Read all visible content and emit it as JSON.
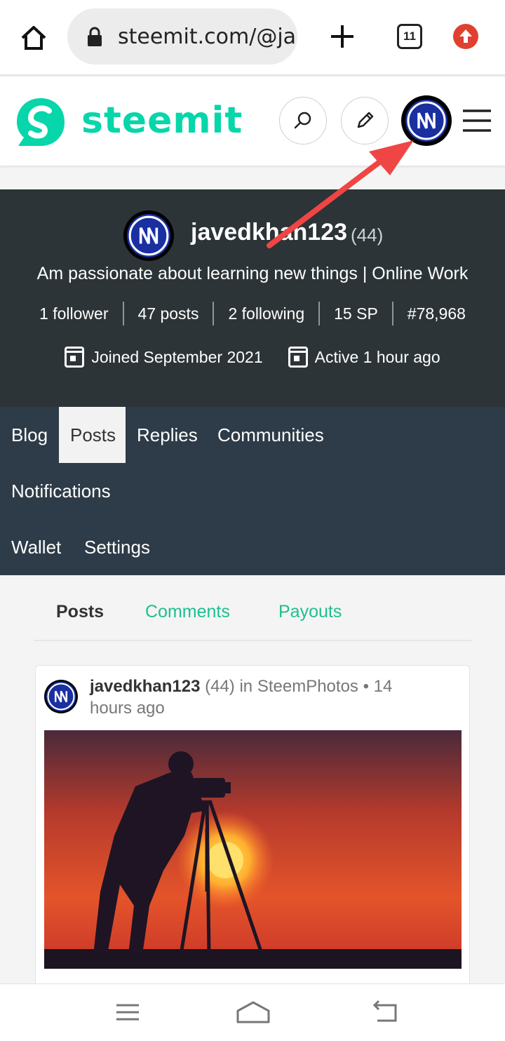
{
  "browser": {
    "url": "steemit.com/@ja",
    "tab_count": "11"
  },
  "header": {
    "logo_text": "steemit",
    "brand_color": "#06d6a9"
  },
  "profile": {
    "username": "javedkhan123",
    "reputation": "(44)",
    "about": "Am passionate about learning new things | Online Work",
    "stats": {
      "followers": "1 follower",
      "posts": "47 posts",
      "following": "2 following",
      "sp": "15 SP",
      "rank": "#78,968"
    },
    "joined": "Joined September 2021",
    "active": "Active 1 hour ago"
  },
  "nav": {
    "blog": "Blog",
    "posts": "Posts",
    "replies": "Replies",
    "communities": "Communities",
    "notifications": "Notifications",
    "wallet": "Wallet",
    "settings": "Settings"
  },
  "filters": {
    "posts": "Posts",
    "comments": "Comments",
    "payouts": "Payouts"
  },
  "post": {
    "author": "javedkhan123",
    "reputation": "(44)",
    "in_label": "in",
    "community": "SteemPhotos",
    "time": "• 14 hours ago"
  },
  "icons": {
    "home": "home-icon",
    "lock": "lock-icon",
    "new_tab": "plus-icon",
    "update": "arrow-up-icon",
    "search": "search-icon",
    "edit": "pencil-icon",
    "menu": "hamburger-icon",
    "calendar": "calendar-icon"
  }
}
